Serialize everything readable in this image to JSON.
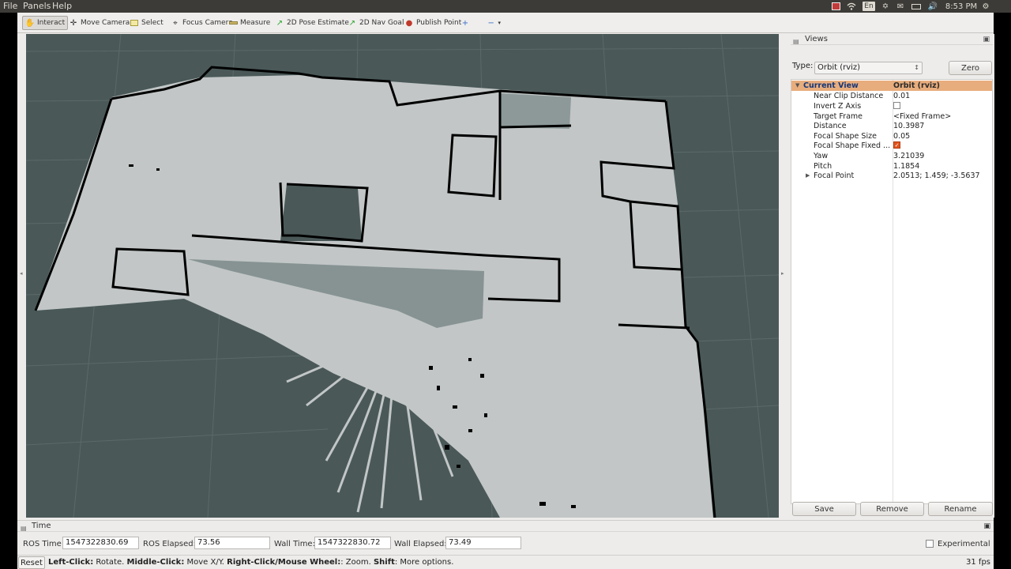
{
  "menu": [
    "File",
    "Panels",
    "Help"
  ],
  "tray": {
    "lang": "En",
    "clock": "8:53 PM"
  },
  "toolbar": [
    {
      "label": "Interact",
      "icon": "hand-icon"
    },
    {
      "label": "Move Camera",
      "icon": "move-camera-icon"
    },
    {
      "label": "Select",
      "icon": "select-icon"
    },
    {
      "label": "Focus Camera",
      "icon": "focus-camera-icon"
    },
    {
      "label": "Measure",
      "icon": "measure-icon"
    },
    {
      "label": "2D Pose Estimate",
      "icon": "pose-arrow-icon"
    },
    {
      "label": "2D Nav Goal",
      "icon": "nav-arrow-icon"
    },
    {
      "label": "Publish Point",
      "icon": "map-pin-icon"
    }
  ],
  "views": {
    "title": "Views",
    "type_label": "Type:",
    "type_value": "Orbit (rviz)",
    "zero_label": "Zero",
    "header": {
      "name": "Current View",
      "value": "Orbit (rviz)"
    },
    "properties": [
      {
        "name": "Near Clip Distance",
        "value": "0.01"
      },
      {
        "name": "Invert Z Axis",
        "value": ""
      },
      {
        "name": "Target Frame",
        "value": "<Fixed Frame>"
      },
      {
        "name": "Distance",
        "value": "10.3987"
      },
      {
        "name": "Focal Shape Size",
        "value": "0.05"
      },
      {
        "name": "Focal Shape Fixed ...",
        "value": ""
      },
      {
        "name": "Yaw",
        "value": "3.21039"
      },
      {
        "name": "Pitch",
        "value": "1.1854"
      },
      {
        "name": "Focal Point",
        "value": "2.0513; 1.459; -3.5637"
      }
    ],
    "save_label": "Save",
    "remove_label": "Remove",
    "rename_label": "Rename"
  },
  "time": {
    "title": "Time",
    "ros_time_label": "ROS Time:",
    "ros_time": "1547322830.69",
    "ros_elapsed_label": "ROS Elapsed:",
    "ros_elapsed": "73.56",
    "wall_time_label": "Wall Time:",
    "wall_time": "1547322830.72",
    "wall_elapsed_label": "Wall Elapsed:",
    "wall_elapsed": "73.49",
    "experimental_label": "Experimental"
  },
  "status": {
    "reset_label": "Reset",
    "hint_b1": "Left-Click:",
    "hint_t1": " Rotate. ",
    "hint_b2": "Middle-Click:",
    "hint_t2": " Move X/Y. ",
    "hint_b3": "Right-Click/Mouse Wheel:",
    "hint_t3": ": Zoom. ",
    "hint_b4": "Shift",
    "hint_t4": ": More options.",
    "fps": "31 fps"
  },
  "colors": {
    "viewport_bg": "#4a5858",
    "map_free": "#c2c6c6",
    "map_occupied": "#000000",
    "header_highlight": "#e8ad7d"
  }
}
